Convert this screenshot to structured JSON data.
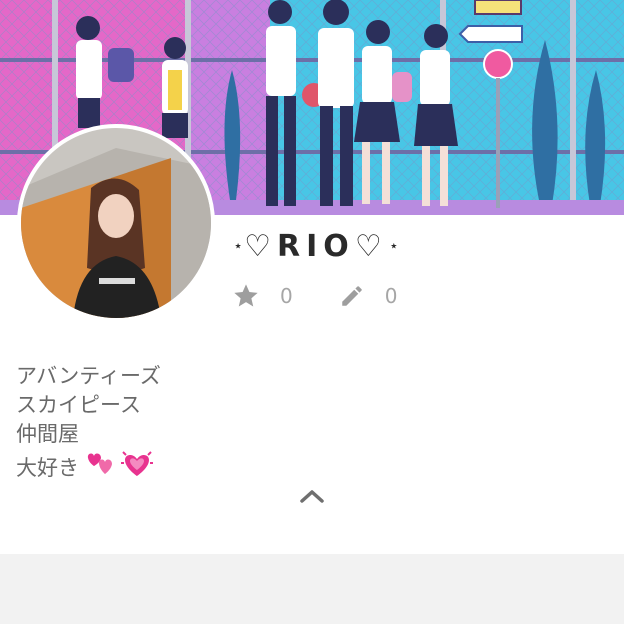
{
  "profile": {
    "name": "RIO",
    "name_star_left": "⋆",
    "name_heart_left": "♡",
    "name_heart_right": "♡",
    "name_star_right": "⋆",
    "stats": [
      {
        "icon": "star-icon",
        "count": "0"
      },
      {
        "icon": "pencil-icon",
        "count": "0"
      }
    ],
    "bio": [
      "アバンティーズ",
      "スカイピース",
      "仲間屋",
      "大好き"
    ],
    "bio_emoji": [
      "two-hearts-icon",
      "beating-heart-icon"
    ]
  },
  "colors": {
    "accent_pink": "#e8338f",
    "icon_gray": "#9e9e9e",
    "text_gray": "#6a6a6a"
  }
}
